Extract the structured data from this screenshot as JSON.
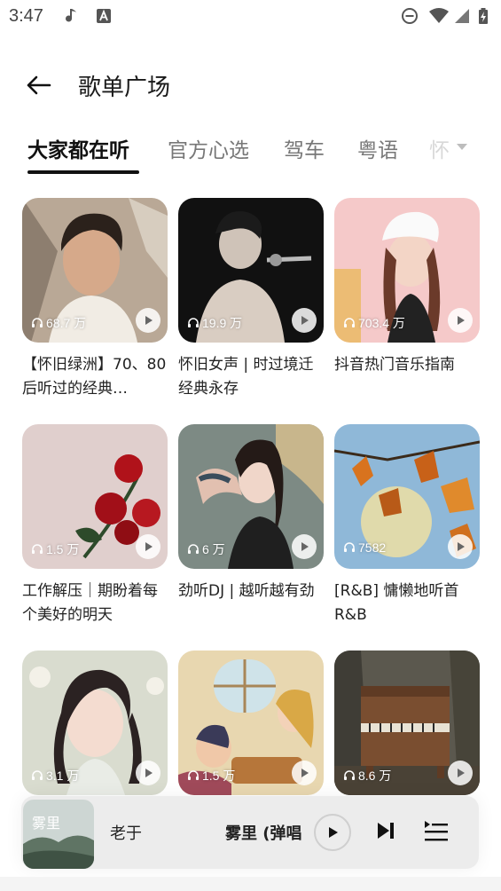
{
  "status_bar": {
    "time": "3:47",
    "icons": [
      "music-note-icon",
      "a-badge-icon",
      "dnd-icon",
      "wifi-icon",
      "signal-icon",
      "battery-charging-icon"
    ]
  },
  "header": {
    "title": "歌单广场",
    "back_icon": "arrow-left-icon"
  },
  "tabs": {
    "items": [
      "大家都在听",
      "官方心选",
      "驾车",
      "粤语",
      "怀"
    ],
    "active_index": 0,
    "dropdown_icon": "caret-down-icon"
  },
  "playlists": [
    {
      "title": "【怀旧绿洲】70、80后听过的经典…",
      "play_count": "68.7 万"
    },
    {
      "title": "怀旧女声 | 时过境迁 经典永存",
      "play_count": "19.9 万"
    },
    {
      "title": "抖音热门音乐指南",
      "play_count": "703.4 万"
    },
    {
      "title": "工作解压｜期盼着每个美好的明天",
      "play_count": "1.5 万"
    },
    {
      "title": "劲听DJ | 越听越有劲",
      "play_count": "6 万"
    },
    {
      "title": "[R&B] 慵懒地听首R&B",
      "play_count": "7582"
    },
    {
      "title": "",
      "play_count": "3.1 万"
    },
    {
      "title": "",
      "play_count": "1.5 万"
    },
    {
      "title": "",
      "play_count": "8.6 万"
    }
  ],
  "mini_player": {
    "cover_text": "雾里",
    "artist": "老于",
    "song": "雾里 (弹唱",
    "icons": [
      "play-icon",
      "skip-next-icon",
      "playlist-icon"
    ]
  },
  "colors": {
    "accent": "#111111",
    "tab_inactive": "#777777",
    "player_bg": "#ececec"
  }
}
